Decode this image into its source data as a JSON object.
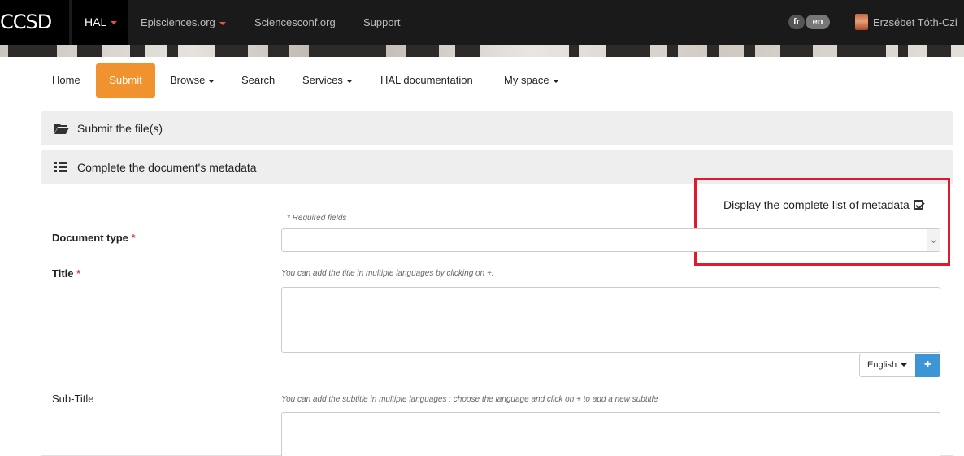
{
  "topbar": {
    "brand": "CCSD",
    "links": [
      {
        "label": "HAL",
        "has_caret": true
      },
      {
        "label": "Episciences.org",
        "has_caret": true
      },
      {
        "label": "Sciencesconf.org",
        "has_caret": false
      },
      {
        "label": "Support",
        "has_caret": false
      }
    ],
    "languages": [
      "fr",
      "en"
    ],
    "user_name": "Erzsébet Tóth-Czi"
  },
  "nav": {
    "items": [
      {
        "label": "Home",
        "dropdown": false
      },
      {
        "label": "Submit",
        "dropdown": false,
        "active": true
      },
      {
        "label": "Browse",
        "dropdown": true
      },
      {
        "label": "Search",
        "dropdown": false
      },
      {
        "label": "Services",
        "dropdown": true
      },
      {
        "label": "HAL documentation",
        "dropdown": false
      },
      {
        "label": "My space",
        "dropdown": true
      }
    ]
  },
  "panels": {
    "submit_files": {
      "title": "Submit the file(s)",
      "icon": "folder-open-icon"
    },
    "metadata": {
      "title": "Complete the document's metadata",
      "icon": "list-icon"
    }
  },
  "form": {
    "display_complete_list": "Display the complete list of metadata",
    "required_note": "* Required fields",
    "document_type": {
      "label": "Document type",
      "required_mark": "*",
      "value": ""
    },
    "title": {
      "label": "Title",
      "required_mark": "*",
      "hint": "You can add the title in multiple languages by clicking on +.",
      "value": ""
    },
    "language_select": "English",
    "add_button": "+",
    "subtitle": {
      "label": "Sub-Title",
      "hint": "You can add the subtitle in multiple languages : choose the language and click on + to add a new subtitle",
      "value": ""
    }
  },
  "colors": {
    "topbar_bg": "#1a1a1a",
    "accent_orange": "#f0922d",
    "primary_blue": "#3e95d6",
    "highlight_red": "#e0192e",
    "required_red": "#d9534f"
  }
}
